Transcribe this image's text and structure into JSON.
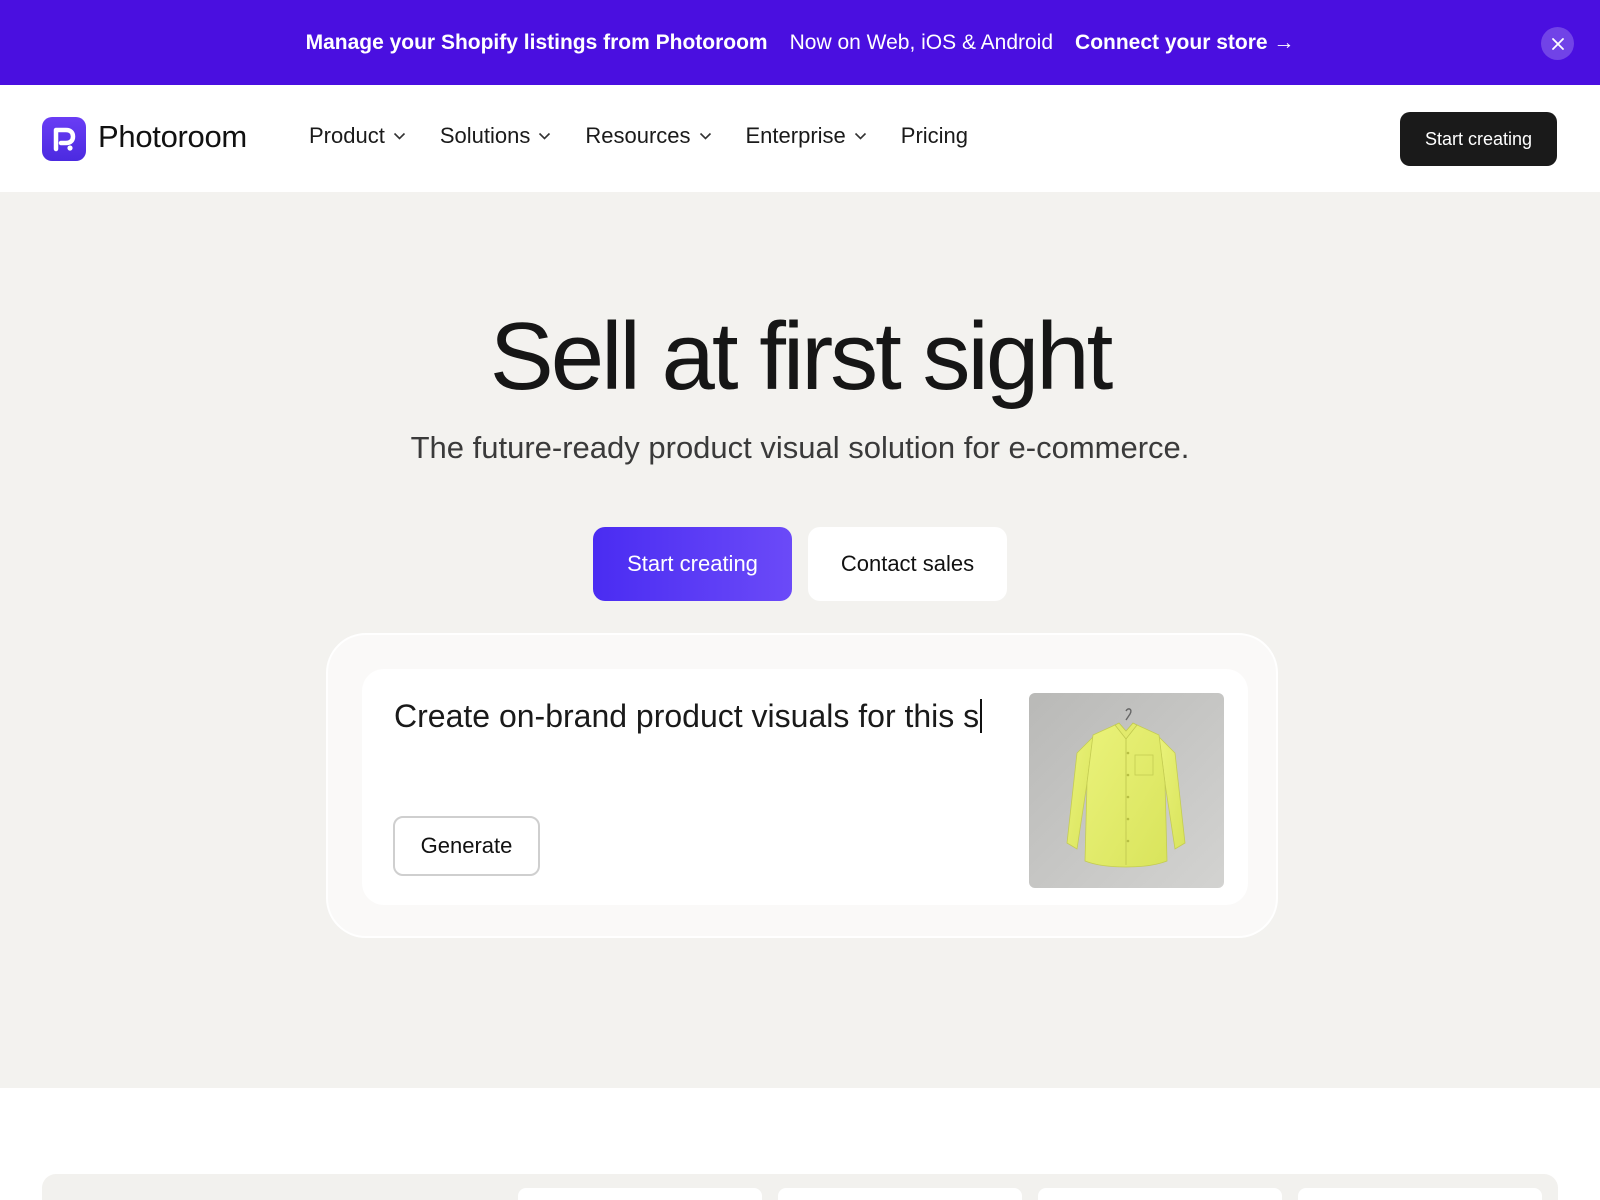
{
  "banner": {
    "headline": "Manage your Shopify listings from Photoroom",
    "availability": "Now on Web, iOS & Android",
    "cta": "Connect your store →",
    "close_icon": "close-icon",
    "background_color": "#4a0fe0"
  },
  "navbar": {
    "logo_icon": "photoroom-logo-icon",
    "brand": "Photoroom",
    "items": [
      {
        "label": "Product",
        "has_dropdown": true
      },
      {
        "label": "Solutions",
        "has_dropdown": true
      },
      {
        "label": "Resources",
        "has_dropdown": true
      },
      {
        "label": "Enterprise",
        "has_dropdown": true
      },
      {
        "label": "Pricing",
        "has_dropdown": false
      }
    ],
    "cta": "Start creating"
  },
  "hero": {
    "title": "Sell at first sight",
    "subtitle": "The future-ready product visual solution for e-commerce.",
    "primary_cta": "Start creating",
    "secondary_cta": "Contact sales",
    "primary_color": "#4a2cf2"
  },
  "prompt_card": {
    "prompt_text": "Create on-brand product visuals for this s",
    "generate_label": "Generate",
    "product_image": "yellow-shirt-on-hanger"
  }
}
